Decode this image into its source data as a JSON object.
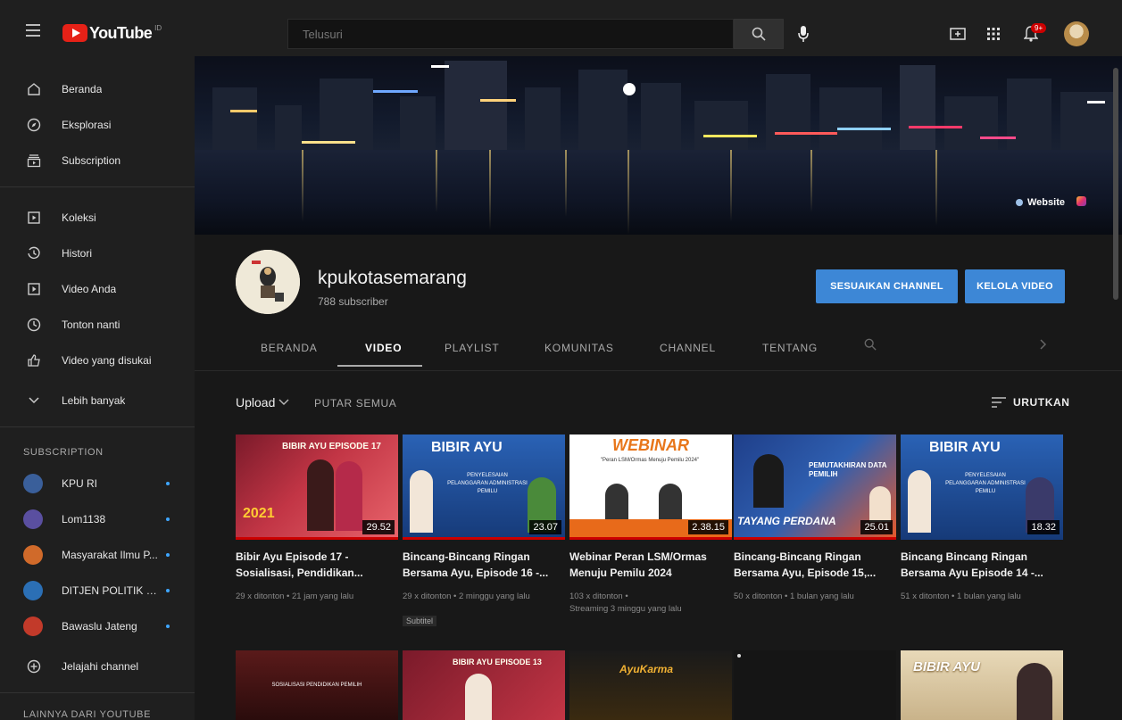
{
  "header": {
    "logo_text": "YouTube",
    "logo_region": "ID",
    "search_placeholder": "Telusuri",
    "notification_count": "9+"
  },
  "sidebar": {
    "main": [
      {
        "label": "Beranda",
        "icon": "home-icon"
      },
      {
        "label": "Eksplorasi",
        "icon": "compass-icon"
      },
      {
        "label": "Subscription",
        "icon": "subscriptions-icon"
      }
    ],
    "library": [
      {
        "label": "Koleksi",
        "icon": "library-icon"
      },
      {
        "label": "Histori",
        "icon": "history-icon"
      },
      {
        "label": "Video Anda",
        "icon": "your-videos-icon"
      },
      {
        "label": "Tonton nanti",
        "icon": "clock-icon"
      },
      {
        "label": "Video yang disukai",
        "icon": "thumbs-up-icon"
      },
      {
        "label": "Lebih banyak",
        "icon": "chevron-down-icon"
      }
    ],
    "subscription_heading": "SUBSCRIPTION",
    "subscriptions": [
      {
        "label": "KPU RI",
        "color": "#3a5f9a"
      },
      {
        "label": "Lom1138",
        "color": "#5a4fa0"
      },
      {
        "label": "Masyarakat Ilmu P...",
        "color": "#d06a2a"
      },
      {
        "label": "DITJEN POLITIK D...",
        "color": "#2b6fb5"
      },
      {
        "label": "Bawaslu Jateng",
        "color": "#c23a2a"
      }
    ],
    "explore_channels": "Jelajahi channel",
    "more_heading": "LAINNYA DARI YOUTUBE"
  },
  "banner": {
    "website_label": "Website"
  },
  "channel": {
    "name": "kpukotasemarang",
    "subscribers": "788 subscriber",
    "customize_button": "SESUAIKAN CHANNEL",
    "manage_button": "KELOLA VIDEO"
  },
  "tabs": [
    {
      "label": "BERANDA",
      "active": false
    },
    {
      "label": "VIDEO",
      "active": true
    },
    {
      "label": "PLAYLIST",
      "active": false
    },
    {
      "label": "KOMUNITAS",
      "active": false
    },
    {
      "label": "CHANNEL",
      "active": false
    },
    {
      "label": "TENTANG",
      "active": false
    }
  ],
  "controls": {
    "upload": "Upload",
    "play_all": "PUTAR SEMUA",
    "sort": "URUTKAN"
  },
  "videos": [
    {
      "title_line1": "Bibir Ayu Episode 17 -",
      "title_line2": "Sosialisasi, Pendidikan...",
      "meta_line1": "29 x ditonton • 21 jam yang lalu",
      "meta_line2": "",
      "tag": "",
      "duration": "29.52",
      "thumb_text": "BIBIR AYU EPISODE 17",
      "thumb_sub": "2021"
    },
    {
      "title_line1": "Bincang-Bincang Ringan",
      "title_line2": "Bersama Ayu, Episode 16 -...",
      "meta_line1": "29 x ditonton • 2 minggu yang lalu",
      "meta_line2": "",
      "tag": "Subtitel",
      "duration": "23.07",
      "thumb_text": "BIBIR AYU",
      "thumb_sub": "PENYELESAIAN PELANGGARAN ADMINISTRASI PEMILU"
    },
    {
      "title_line1": "Webinar Peran LSM/Ormas",
      "title_line2": "Menuju Pemilu 2024",
      "meta_line1": "103 x ditonton •",
      "meta_line2": "Streaming 3 minggu yang lalu",
      "tag": "",
      "duration": "2.38.15",
      "thumb_text": "WEBINAR",
      "thumb_sub": "\"Peran LSM/Ormas Menuju Pemilu 2024\""
    },
    {
      "title_line1": "Bincang-Bincang Ringan",
      "title_line2": "Bersama Ayu, Episode 15,...",
      "meta_line1": "50 x ditonton • 1 bulan yang lalu",
      "meta_line2": "",
      "tag": "",
      "duration": "25.01",
      "thumb_text": "PEMUTAKHIRAN DATA PEMILIH",
      "thumb_sub": "TAYANG PERDANA"
    },
    {
      "title_line1": "Bincang Bincang Ringan",
      "title_line2": "Bersama Ayu Episode 14 -...",
      "meta_line1": "51 x ditonton • 1 bulan yang lalu",
      "meta_line2": "",
      "tag": "",
      "duration": "18.32",
      "thumb_text": "BIBIR AYU",
      "thumb_sub": "PENYELESAIAN PELANGGARAN ADMINISTRASI PEMILU"
    }
  ],
  "row2_thumbs": [
    {
      "thumb_text": "SOSIALISASI PENDIDIKAN PEMILIH"
    },
    {
      "thumb_text": "BIBIR AYU EPISODE 13"
    },
    {
      "thumb_text": "AyuKarma"
    },
    {
      "thumb_text": ""
    },
    {
      "thumb_text": "BIBIR AYU"
    }
  ],
  "colors": {
    "accent_blue": "#3d87d6",
    "youtube_red": "#e62117",
    "background": "#181818",
    "panel": "#1f1f1f"
  }
}
